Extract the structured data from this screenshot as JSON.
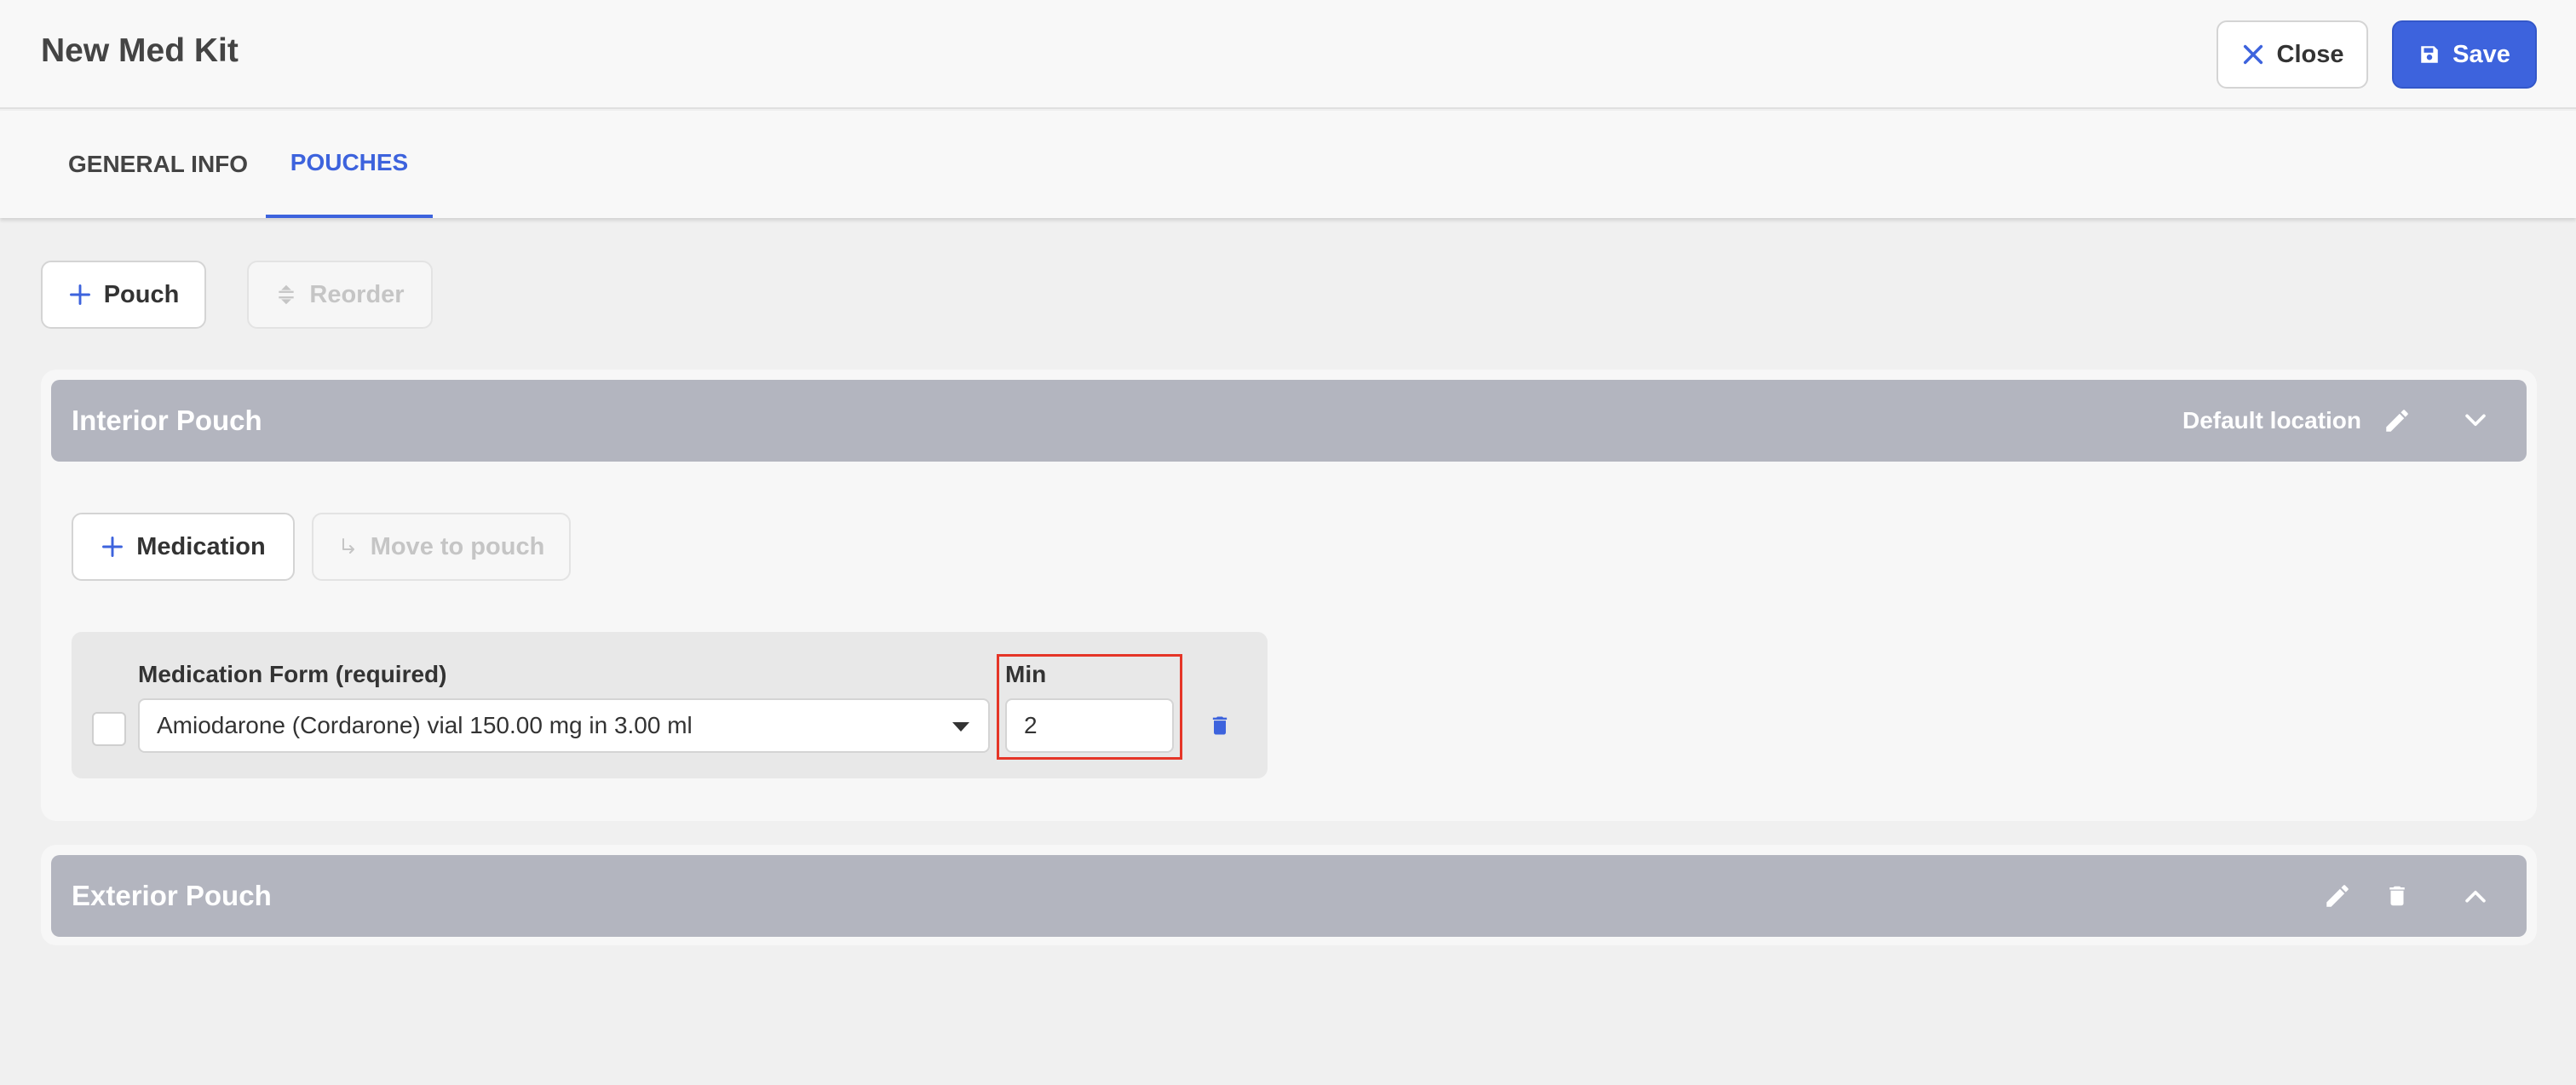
{
  "header": {
    "title": "New Med Kit",
    "close_label": "Close",
    "save_label": "Save"
  },
  "tabs": [
    {
      "label": "GENERAL INFO",
      "active": false
    },
    {
      "label": "POUCHES",
      "active": true
    }
  ],
  "toolbar": {
    "pouch_label": "Pouch",
    "reorder_label": "Reorder"
  },
  "pouches": [
    {
      "name": "Interior Pouch",
      "location_label": "Default location",
      "expanded": true,
      "add_medication_label": "Medication",
      "move_to_pouch_label": "Move to pouch",
      "medications": [
        {
          "form_label": "Medication Form (required)",
          "form_value": "Amiodarone (Cordarone) vial 150.00 mg in 3.00 ml",
          "min_label": "Min",
          "min_value": "2"
        }
      ]
    },
    {
      "name": "Exterior Pouch",
      "expanded": false
    }
  ],
  "colors": {
    "accent": "#3d63dd",
    "pouch_header": "#b3b5bf",
    "highlight": "#e53527"
  }
}
